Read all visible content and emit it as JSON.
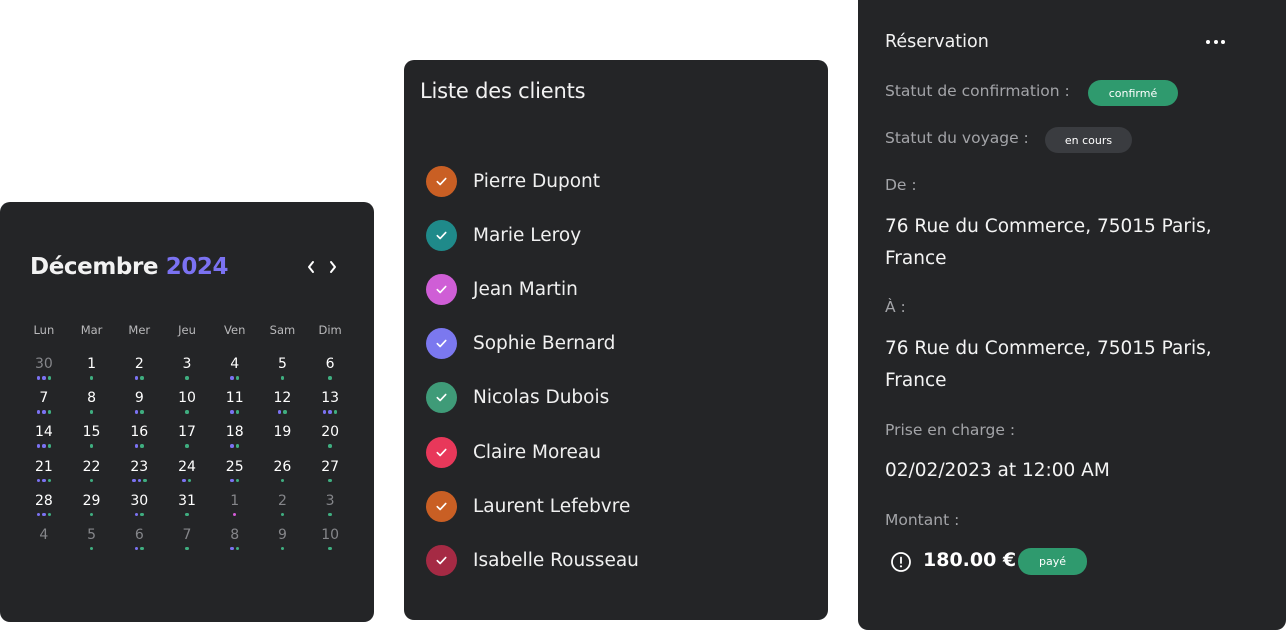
{
  "calendar": {
    "month": "Décembre",
    "year": "2024",
    "prev_icon": "‹",
    "next_icon": "›",
    "weekdays": [
      "Lun",
      "Mar",
      "Mer",
      "Jeu",
      "Ven",
      "Sam",
      "Dim"
    ],
    "dot_colors": {
      "green": "#3fae80",
      "purple": "#7b72f2",
      "pink": "#d45bd6"
    },
    "days": [
      {
        "d": "30",
        "m": true,
        "dots": [
          "purple",
          "purple",
          "green"
        ]
      },
      {
        "d": "1",
        "m": false,
        "dots": [
          "green"
        ]
      },
      {
        "d": "2",
        "m": false,
        "dots": [
          "purple",
          "green"
        ]
      },
      {
        "d": "3",
        "m": false,
        "dots": [
          "green"
        ]
      },
      {
        "d": "4",
        "m": false,
        "dots": [
          "purple",
          "green"
        ]
      },
      {
        "d": "5",
        "m": false,
        "dots": [
          "green"
        ]
      },
      {
        "d": "6",
        "m": false,
        "dots": [
          "green"
        ]
      },
      {
        "d": "7",
        "m": false,
        "dots": [
          "purple",
          "purple",
          "green"
        ]
      },
      {
        "d": "8",
        "m": false,
        "dots": [
          "green"
        ]
      },
      {
        "d": "9",
        "m": false,
        "dots": [
          "purple",
          "green"
        ]
      },
      {
        "d": "10",
        "m": false,
        "dots": [
          "green"
        ]
      },
      {
        "d": "11",
        "m": false,
        "dots": [
          "purple",
          "green"
        ]
      },
      {
        "d": "12",
        "m": false,
        "dots": [
          "purple",
          "green"
        ]
      },
      {
        "d": "13",
        "m": false,
        "dots": [
          "purple",
          "purple",
          "green"
        ]
      },
      {
        "d": "14",
        "m": false,
        "dots": [
          "purple",
          "purple",
          "green"
        ]
      },
      {
        "d": "15",
        "m": false,
        "dots": [
          "green"
        ]
      },
      {
        "d": "16",
        "m": false,
        "dots": [
          "purple",
          "green"
        ]
      },
      {
        "d": "17",
        "m": false,
        "dots": [
          "green"
        ]
      },
      {
        "d": "18",
        "m": false,
        "dots": [
          "purple",
          "green"
        ]
      },
      {
        "d": "19",
        "m": false,
        "dots": []
      },
      {
        "d": "20",
        "m": false,
        "dots": [
          "green"
        ]
      },
      {
        "d": "21",
        "m": false,
        "dots": [
          "purple",
          "purple",
          "green"
        ]
      },
      {
        "d": "22",
        "m": false,
        "dots": [
          "green"
        ]
      },
      {
        "d": "23",
        "m": false,
        "dots": [
          "purple",
          "purple",
          "green"
        ]
      },
      {
        "d": "24",
        "m": false,
        "dots": [
          "purple",
          "green"
        ]
      },
      {
        "d": "25",
        "m": false,
        "dots": [
          "purple",
          "green"
        ]
      },
      {
        "d": "26",
        "m": false,
        "dots": [
          "green"
        ]
      },
      {
        "d": "27",
        "m": false,
        "dots": [
          "green"
        ]
      },
      {
        "d": "28",
        "m": false,
        "dots": [
          "purple",
          "purple",
          "green"
        ]
      },
      {
        "d": "29",
        "m": false,
        "dots": [
          "green"
        ]
      },
      {
        "d": "30",
        "m": false,
        "dots": [
          "purple",
          "green"
        ]
      },
      {
        "d": "31",
        "m": false,
        "dots": [
          "green"
        ]
      },
      {
        "d": "1",
        "m": true,
        "dots": [
          "pink"
        ]
      },
      {
        "d": "2",
        "m": true,
        "dots": [
          "green"
        ]
      },
      {
        "d": "3",
        "m": true,
        "dots": [
          "green"
        ]
      },
      {
        "d": "4",
        "m": true,
        "dots": []
      },
      {
        "d": "5",
        "m": true,
        "dots": [
          "green"
        ]
      },
      {
        "d": "6",
        "m": true,
        "dots": [
          "purple",
          "green"
        ]
      },
      {
        "d": "7",
        "m": true,
        "dots": [
          "green"
        ]
      },
      {
        "d": "8",
        "m": true,
        "dots": [
          "purple",
          "green"
        ]
      },
      {
        "d": "9",
        "m": true,
        "dots": [
          "green"
        ]
      },
      {
        "d": "10",
        "m": true,
        "dots": [
          "green"
        ]
      }
    ]
  },
  "clients": {
    "title": "Liste des clients",
    "items": [
      {
        "name": "Pierre Dupont",
        "color": "#c95f24"
      },
      {
        "name": "Marie Leroy",
        "color": "#1f8a8a"
      },
      {
        "name": "Jean Martin",
        "color": "#cf5ed6"
      },
      {
        "name": "Sophie Bernard",
        "color": "#7b78ef"
      },
      {
        "name": "Nicolas Dubois",
        "color": "#3f9b78"
      },
      {
        "name": "Claire Moreau",
        "color": "#e8385a"
      },
      {
        "name": "Laurent Lefebvre",
        "color": "#c95f24"
      },
      {
        "name": "Isabelle Rousseau",
        "color": "#a52a44"
      }
    ]
  },
  "reservation": {
    "title": "Réservation",
    "confirmation_label": "Statut de confirmation :",
    "confirmation_badge": "confirmé",
    "trip_label": "Statut du voyage :",
    "trip_badge": "en cours",
    "from_label": "De :",
    "from_value": "76 Rue du Commerce, 75015 Paris, France",
    "to_label": "À :",
    "to_value": "76 Rue du Commerce, 75015 Paris, France",
    "pickup_label": "Prise en charge :",
    "pickup_value": "02/02/2023 at 12:00 AM",
    "amount_label": "Montant :",
    "amount_value": "180.00 €",
    "payment_badge": "payé",
    "colors": {
      "confirmed": "#2f9a6e",
      "in_progress": "#3a3c40",
      "paid": "#2f9a6e"
    }
  }
}
